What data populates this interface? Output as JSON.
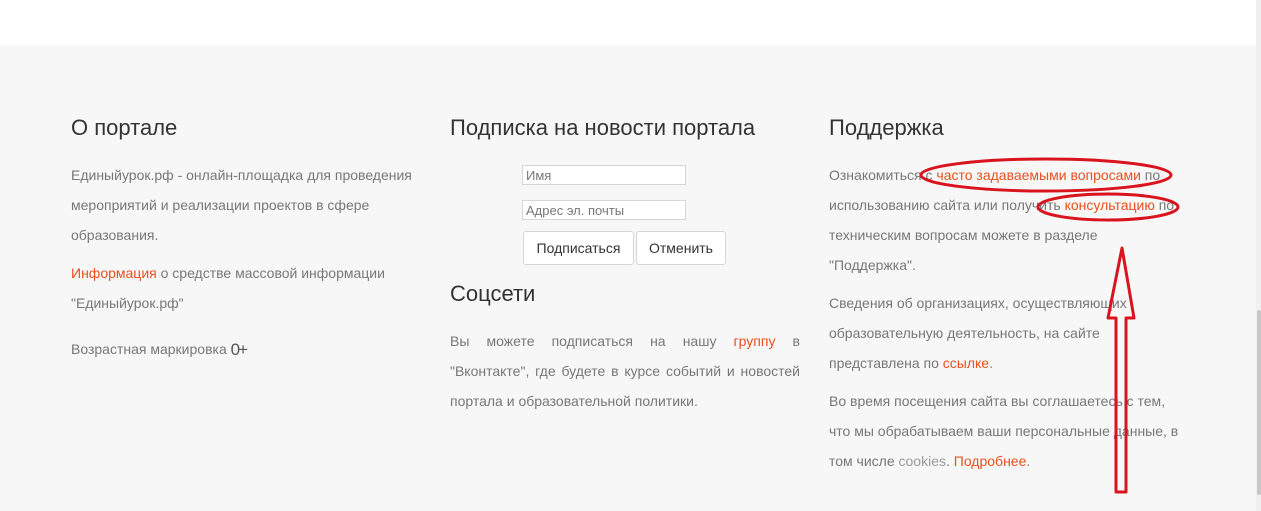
{
  "about": {
    "title": "О портале",
    "desc": "Единыйурок.рф - онлайн-площадка для проведения мероприятий и реализации проектов в сфере образования.",
    "info_link": "Информация",
    "info_text": " о средстве массовой информации \"Единыйурок.рф\"",
    "age_label": "Возрастная маркировка ",
    "age_value": "0+"
  },
  "subscribe": {
    "title": "Подписка на новости портала",
    "name_placeholder": "Имя",
    "email_placeholder": "Адрес эл. почты",
    "subscribe_button": "Подписаться",
    "cancel_button": "Отменить"
  },
  "social": {
    "title": "Соцсети",
    "text_before": "Вы можете подписаться на нашу ",
    "group_link": "группу",
    "text_after": " в \"Вконтакте\", где будете в курсе событий и новостей портала и образовательной политики."
  },
  "support": {
    "title": "Поддержка",
    "p1_before": "Ознакомиться с ",
    "faq_link": "часто задаваемыми вопросами",
    "p1_mid": " по использованию сайта или получить ",
    "consult_link": "консультацию",
    "p1_after": " по техническим вопросам можете в разделе \"Поддержка\".",
    "p2_before": "Сведения об организациях, осуществляющих образовательную деятельность, на сайте представлена по ",
    "p2_link": "ссылке",
    "p2_after": ".",
    "p3_before": "Во время посещения сайта вы соглашаетесь с тем, что мы обрабатываем ваши персональные данные, в том числе ",
    "cookies_text": "cookies",
    "p3_mid": ". ",
    "more_link": "Подробнее",
    "p3_after": "."
  },
  "colors": {
    "link": "#e8501e",
    "annotation": "#d9141e",
    "footer_bg": "#f7f7f7"
  }
}
